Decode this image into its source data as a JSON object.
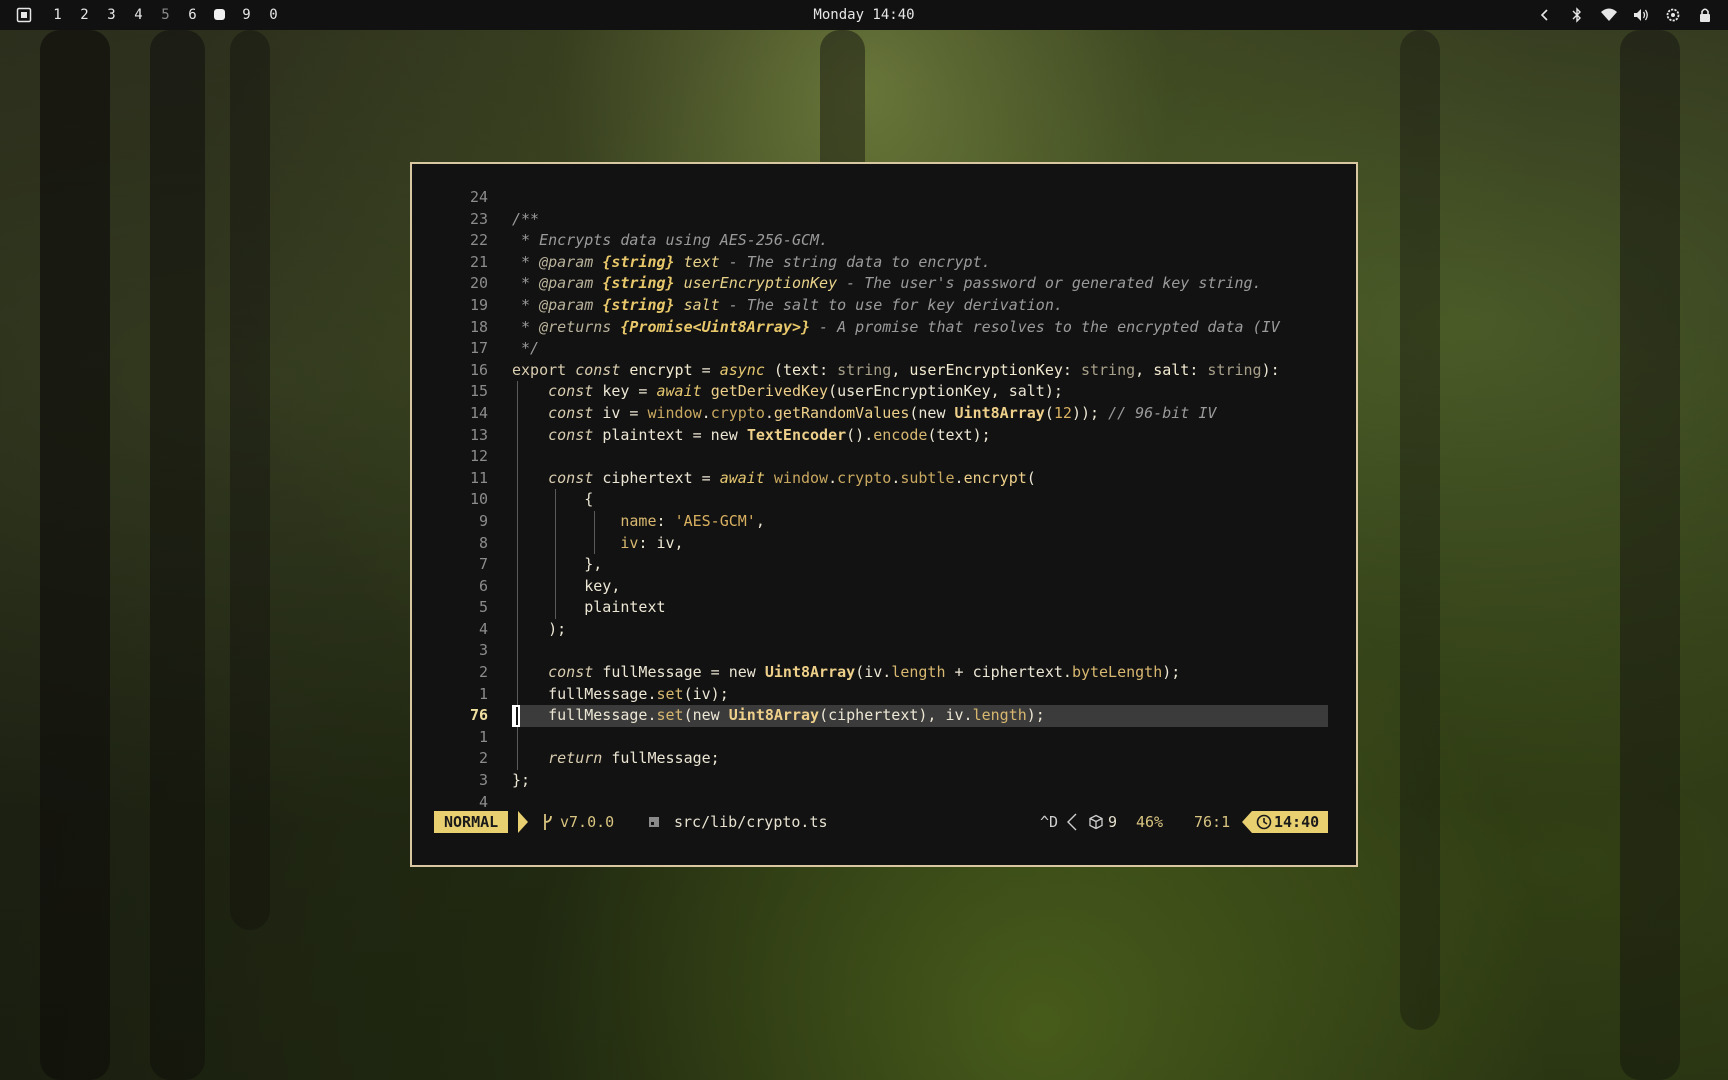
{
  "topbar": {
    "workspaces": [
      {
        "label": "1",
        "state": "normal"
      },
      {
        "label": "2",
        "state": "normal"
      },
      {
        "label": "3",
        "state": "normal"
      },
      {
        "label": "4",
        "state": "normal"
      },
      {
        "label": "5",
        "state": "dim"
      },
      {
        "label": "6",
        "state": "normal"
      },
      {
        "label": "",
        "state": "active"
      },
      {
        "label": "9",
        "state": "normal"
      },
      {
        "label": "0",
        "state": "normal"
      }
    ],
    "clock": "Monday 14:40",
    "tray_icons": [
      "chevron-left-icon",
      "bluetooth-icon",
      "wifi-icon",
      "volume-icon",
      "settings-icon",
      "lock-icon"
    ]
  },
  "editor": {
    "lines": [
      {
        "num": "24",
        "tokens": []
      },
      {
        "num": "23",
        "tokens": [
          [
            "cm",
            "/**"
          ]
        ]
      },
      {
        "num": "22",
        "tokens": [
          [
            "cm",
            " * Encrypts data using AES-256-GCM."
          ]
        ]
      },
      {
        "num": "21",
        "tokens": [
          [
            "cm",
            " * "
          ],
          [
            "tg",
            "@param"
          ],
          [
            "cm",
            " "
          ],
          [
            "ty",
            "{string}"
          ],
          [
            "cm",
            " "
          ],
          [
            "pn",
            "text"
          ],
          [
            "cm",
            " - The string data to encrypt."
          ]
        ]
      },
      {
        "num": "20",
        "tokens": [
          [
            "cm",
            " * "
          ],
          [
            "tg",
            "@param"
          ],
          [
            "cm",
            " "
          ],
          [
            "ty",
            "{string}"
          ],
          [
            "cm",
            " "
          ],
          [
            "pn",
            "userEncryptionKey"
          ],
          [
            "cm",
            " - The user's password or generated key string."
          ]
        ]
      },
      {
        "num": "19",
        "tokens": [
          [
            "cm",
            " * "
          ],
          [
            "tg",
            "@param"
          ],
          [
            "cm",
            " "
          ],
          [
            "ty",
            "{string}"
          ],
          [
            "cm",
            " "
          ],
          [
            "pn",
            "salt"
          ],
          [
            "cm",
            " - The salt to use for key derivation."
          ]
        ]
      },
      {
        "num": "18",
        "tokens": [
          [
            "cm",
            " * "
          ],
          [
            "tg",
            "@returns"
          ],
          [
            "cm",
            " "
          ],
          [
            "ty",
            "{Promise<Uint8Array>}"
          ],
          [
            "cm",
            " - A promise that resolves to the encrypted data (IV"
          ]
        ]
      },
      {
        "num": "17",
        "tokens": [
          [
            "cm",
            " */"
          ]
        ]
      },
      {
        "num": "16",
        "tokens": [
          [
            "kw",
            "export "
          ],
          [
            "kwi",
            "const "
          ],
          [
            "vb",
            "encrypt"
          ],
          [
            "id",
            " = "
          ],
          [
            "yk",
            "async"
          ],
          [
            "id",
            " ("
          ],
          [
            "vb",
            "text"
          ],
          [
            "id",
            ": "
          ],
          [
            "tyg",
            "string"
          ],
          [
            "id",
            ", "
          ],
          [
            "vb",
            "userEncryptionKey"
          ],
          [
            "id",
            ": "
          ],
          [
            "tyg",
            "string"
          ],
          [
            "id",
            ", "
          ],
          [
            "vb",
            "salt"
          ],
          [
            "id",
            ": "
          ],
          [
            "tyg",
            "string"
          ],
          [
            "id",
            "):"
          ]
        ]
      },
      {
        "num": "15",
        "guides": [
          1
        ],
        "tokens": [
          [
            "id",
            "    "
          ],
          [
            "kwi",
            "const "
          ],
          [
            "id",
            "key = "
          ],
          [
            "yk",
            "await "
          ],
          [
            "fn",
            "getDerivedKey"
          ],
          [
            "id",
            "(userEncryptionKey, salt);"
          ]
        ]
      },
      {
        "num": "14",
        "guides": [
          1
        ],
        "tokens": [
          [
            "id",
            "    "
          ],
          [
            "kwi",
            "const "
          ],
          [
            "id",
            "iv = "
          ],
          [
            "gl",
            "window"
          ],
          [
            "id",
            "."
          ],
          [
            "gl",
            "crypto"
          ],
          [
            "id",
            "."
          ],
          [
            "fn",
            "getRandomValues"
          ],
          [
            "id",
            "(new "
          ],
          [
            "cls",
            "Uint8Array"
          ],
          [
            "id",
            "("
          ],
          [
            "st",
            "12"
          ],
          [
            "id",
            ")); "
          ],
          [
            "cm",
            "// 96-bit IV"
          ]
        ]
      },
      {
        "num": "13",
        "guides": [
          1
        ],
        "tokens": [
          [
            "id",
            "    "
          ],
          [
            "kwi",
            "const "
          ],
          [
            "id",
            "plaintext = new "
          ],
          [
            "cls",
            "TextEncoder"
          ],
          [
            "id",
            "()."
          ],
          [
            "mt",
            "encode"
          ],
          [
            "id",
            "(text);"
          ]
        ]
      },
      {
        "num": "12",
        "guides": [
          1
        ],
        "tokens": []
      },
      {
        "num": "11",
        "guides": [
          1
        ],
        "tokens": [
          [
            "id",
            "    "
          ],
          [
            "kwi",
            "const "
          ],
          [
            "id",
            "ciphertext = "
          ],
          [
            "yk",
            "await "
          ],
          [
            "gl",
            "window"
          ],
          [
            "id",
            "."
          ],
          [
            "gl",
            "crypto"
          ],
          [
            "id",
            "."
          ],
          [
            "gl",
            "subtle"
          ],
          [
            "id",
            "."
          ],
          [
            "fn",
            "encrypt"
          ],
          [
            "id",
            "("
          ]
        ]
      },
      {
        "num": "10",
        "guides": [
          1,
          2
        ],
        "tokens": [
          [
            "id",
            "        {"
          ]
        ]
      },
      {
        "num": "9",
        "guides": [
          1,
          2,
          3
        ],
        "tokens": [
          [
            "id",
            "            "
          ],
          [
            "mt",
            "name"
          ],
          [
            "id",
            ": "
          ],
          [
            "st",
            "'AES-GCM'"
          ],
          [
            "id",
            ","
          ]
        ]
      },
      {
        "num": "8",
        "guides": [
          1,
          2,
          3
        ],
        "tokens": [
          [
            "id",
            "            "
          ],
          [
            "mt",
            "iv"
          ],
          [
            "id",
            ": iv,"
          ]
        ]
      },
      {
        "num": "7",
        "guides": [
          1,
          2
        ],
        "tokens": [
          [
            "id",
            "        },"
          ]
        ]
      },
      {
        "num": "6",
        "guides": [
          1,
          2
        ],
        "tokens": [
          [
            "id",
            "        key,"
          ]
        ]
      },
      {
        "num": "5",
        "guides": [
          1,
          2
        ],
        "tokens": [
          [
            "id",
            "        plaintext"
          ]
        ]
      },
      {
        "num": "4",
        "guides": [
          1
        ],
        "tokens": [
          [
            "id",
            "    );"
          ]
        ]
      },
      {
        "num": "3",
        "guides": [
          1
        ],
        "tokens": []
      },
      {
        "num": "2",
        "guides": [
          1
        ],
        "tokens": [
          [
            "id",
            "    "
          ],
          [
            "kwi",
            "const "
          ],
          [
            "id",
            "fullMessage = new "
          ],
          [
            "cls",
            "Uint8Array"
          ],
          [
            "id",
            "(iv."
          ],
          [
            "mt",
            "length"
          ],
          [
            "id",
            " + ciphertext."
          ],
          [
            "mt",
            "byteLength"
          ],
          [
            "id",
            ");"
          ]
        ]
      },
      {
        "num": "1",
        "guides": [
          1
        ],
        "tokens": [
          [
            "id",
            "    fullMessage."
          ],
          [
            "mt",
            "set"
          ],
          [
            "id",
            "(iv);"
          ]
        ]
      },
      {
        "num": "76",
        "current": true,
        "tokens": [
          [
            "id",
            "    fullMessage."
          ],
          [
            "mt",
            "set"
          ],
          [
            "id",
            "(new "
          ],
          [
            "cls",
            "Uint8Array"
          ],
          [
            "id",
            "(ciphertext), iv."
          ],
          [
            "mt",
            "length"
          ],
          [
            "id",
            ");"
          ]
        ]
      },
      {
        "num": "1",
        "guides": [
          1
        ],
        "tokens": []
      },
      {
        "num": "2",
        "guides": [
          1
        ],
        "tokens": [
          [
            "id",
            "    "
          ],
          [
            "kwi",
            "return "
          ],
          [
            "id",
            "fullMessage;"
          ]
        ]
      },
      {
        "num": "3",
        "tokens": [
          [
            "id",
            "};"
          ]
        ]
      },
      {
        "num": "4",
        "tokens": []
      }
    ]
  },
  "statusline": {
    "mode": "NORMAL",
    "branch": "v7.0.0",
    "file": "src/lib/crypto.ts",
    "key": "^D",
    "diagnostics": "9",
    "percent": "46%",
    "position": "76:1",
    "time": "14:40"
  },
  "colors": {
    "accent": "#e8d070",
    "window_border": "#d8c7a0",
    "editor_bg": "#121212",
    "topbar_bg": "#111111"
  }
}
